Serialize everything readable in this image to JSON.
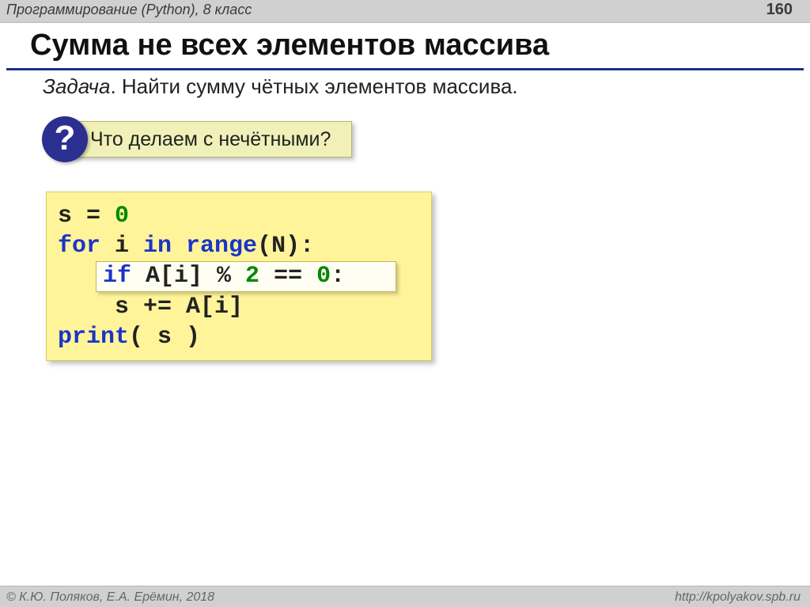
{
  "header": {
    "breadcrumb": "Программирование (Python), 8 класс",
    "page_number": "160"
  },
  "title": "Сумма не всех элементов массива",
  "task": {
    "label": "Задача",
    "text": ". Найти сумму чётных элементов массива."
  },
  "question": {
    "mark": "?",
    "text": "Что делаем с нечётными?"
  },
  "code": {
    "l1": {
      "p1": "s ",
      "p2": "= ",
      "p3": "0"
    },
    "l2": {
      "p1": "for ",
      "p2": "i ",
      "p3": "in ",
      "p4": "range",
      "p5": "(N):"
    },
    "l3": {
      "p1": "if ",
      "p2": "A[i] % ",
      "p3": "2",
      "p4": " == ",
      "p5": "0",
      "p6": ":"
    },
    "l4": "    s += A[i]",
    "l5": {
      "p1": "print",
      "p2": "( s )"
    }
  },
  "footer": {
    "left": "© К.Ю. Поляков, Е.А. Ерёмин, 2018",
    "right": "http://kpolyakov.spb.ru"
  }
}
